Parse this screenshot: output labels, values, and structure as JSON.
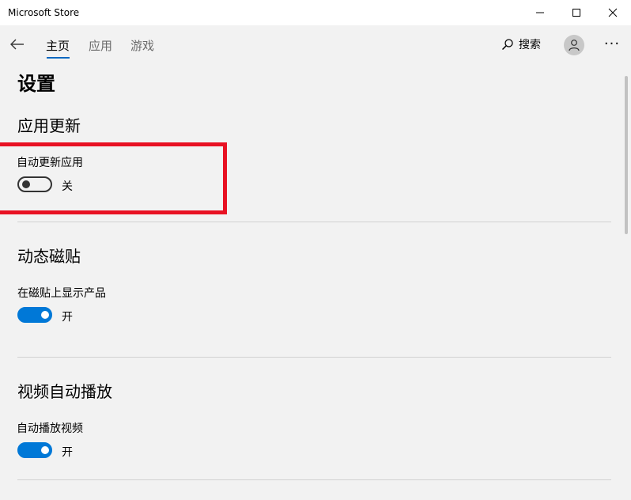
{
  "window": {
    "title": "Microsoft Store"
  },
  "nav": {
    "tabs": [
      {
        "label": "主页",
        "active": true
      },
      {
        "label": "应用",
        "active": false
      },
      {
        "label": "游戏",
        "active": false
      }
    ],
    "search_label": "搜索",
    "more_label": "···"
  },
  "page": {
    "title": "设置"
  },
  "sections": [
    {
      "title": "应用更新",
      "setting_label": "自动更新应用",
      "toggle_on": false,
      "state_text": "关"
    },
    {
      "title": "动态磁贴",
      "setting_label": "在磁贴上显示产品",
      "toggle_on": true,
      "state_text": "开"
    },
    {
      "title": "视频自动播放",
      "setting_label": "自动播放视频",
      "toggle_on": true,
      "state_text": "开"
    }
  ],
  "colors": {
    "accent": "#0078d7",
    "highlight": "#e81123",
    "background": "#f2f2f2"
  },
  "icons": {
    "minimize": "minimize-icon",
    "maximize": "maximize-icon",
    "close": "close-icon",
    "back": "back-arrow-icon",
    "search": "search-icon",
    "avatar": "user-avatar-icon",
    "more": "more-icon"
  }
}
